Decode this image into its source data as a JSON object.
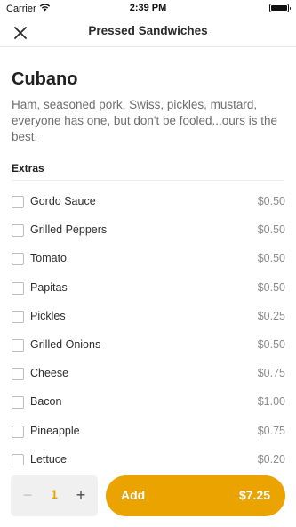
{
  "status": {
    "carrier": "Carrier",
    "time": "2:39 PM",
    "battery_level": 1.0
  },
  "nav": {
    "title": "Pressed Sandwiches"
  },
  "product": {
    "name": "Cubano",
    "description": "Ham, seasoned pork, Swiss, pickles, mustard, everyone has one, but don't be fooled...ours is the best."
  },
  "extras": {
    "title": "Extras",
    "items": [
      {
        "name": "Gordo Sauce",
        "price": "$0.50"
      },
      {
        "name": "Grilled Peppers",
        "price": "$0.50"
      },
      {
        "name": "Tomato",
        "price": "$0.50"
      },
      {
        "name": "Papitas",
        "price": "$0.50"
      },
      {
        "name": "Pickles",
        "price": "$0.25"
      },
      {
        "name": "Grilled Onions",
        "price": "$0.50"
      },
      {
        "name": "Cheese",
        "price": "$0.75"
      },
      {
        "name": "Bacon",
        "price": "$1.00"
      },
      {
        "name": "Pineapple",
        "price": "$0.75"
      },
      {
        "name": "Lettuce",
        "price": "$0.20"
      }
    ]
  },
  "cart": {
    "minus": "−",
    "quantity": "1",
    "plus": "+",
    "add_label": "Add",
    "total": "$7.25"
  },
  "colors": {
    "accent": "#eba300",
    "quantity": "#e8a200"
  }
}
